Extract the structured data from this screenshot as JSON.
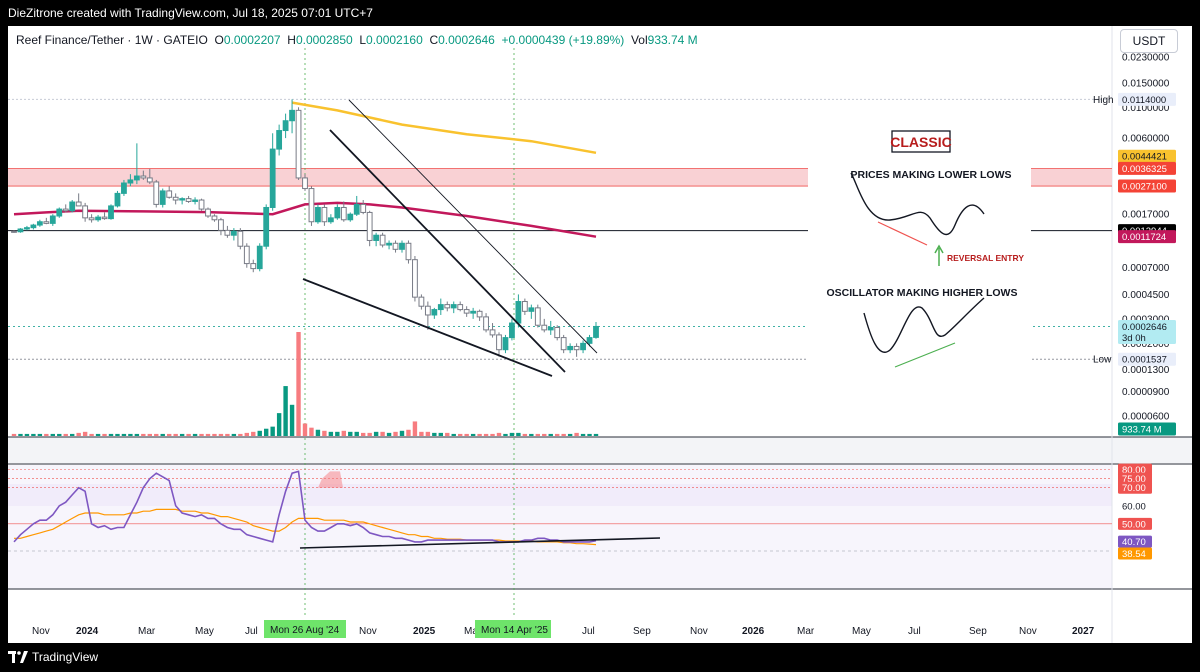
{
  "header": {
    "credit": "DieZitrone created with TradingView.com, Jul 18, 2025 07:01 UTC+7"
  },
  "footer": {
    "brand": "TradingView"
  },
  "legend": {
    "symbol": "Reef Finance/Tether · 1W · GATEIO",
    "o_label": "O",
    "o": "0.0002207",
    "h_label": "H",
    "h": "0.0002850",
    "l_label": "L",
    "l": "0.0002160",
    "c_label": "C",
    "c": "0.0002646",
    "change": "+0.0000439 (+19.89%)",
    "vol_label": "Vol",
    "vol": "933.74 M"
  },
  "currency_button": "USDT",
  "colors": {
    "up": "#26a69a",
    "down": "#ef5350",
    "upvol": "#089981",
    "downvol": "#f77c80",
    "ma_fast": "#f9c22e",
    "ma_slow": "#c2185b",
    "rsi": "#7e57c2",
    "rsi_ma": "#ff9800"
  },
  "chart_data": [
    {
      "type": "candlestick",
      "scale": "log",
      "price_axis_ticks": [
        "0.0230000",
        "0.0150000",
        "0.0100000",
        "0.0060000",
        "0.0027100",
        "0.0017000",
        "0.0007000",
        "0.0004500",
        "0.0003000",
        "0.0002000",
        "0.0001300",
        "0.0000900",
        "0.0000600"
      ],
      "price_labels": [
        {
          "text": "High",
          "value": "0.0114000",
          "kind": "high"
        },
        {
          "text": "",
          "value": "0.0044421",
          "kind": "ma_fast"
        },
        {
          "text": "",
          "value": "0.0036325",
          "kind": "red"
        },
        {
          "text": "",
          "value": "0.0027100",
          "kind": "red"
        },
        {
          "text": "",
          "value": "0.0012944",
          "kind": "black"
        },
        {
          "text": "",
          "value": "0.0011724",
          "kind": "ma_slow"
        },
        {
          "text": "",
          "value": "0.0002646",
          "kind": "last"
        },
        {
          "text": "",
          "value": "3d 0h",
          "kind": "last"
        },
        {
          "text": "Low",
          "value": "0.0001537",
          "kind": "low"
        },
        {
          "text": "",
          "value": "933.74 M",
          "kind": "vol"
        }
      ],
      "time_axis": [
        "Nov",
        "2024",
        "Mar",
        "May",
        "Jul",
        "Sep",
        "Nov",
        "2025",
        "Mar",
        "May",
        "Jul",
        "Sep",
        "Nov",
        "2026",
        "Mar",
        "May",
        "Jul",
        "Sep",
        "Nov",
        "2027"
      ],
      "time_highlights": [
        "Mon 26 Aug '24",
        "Mon 14 Apr '25"
      ],
      "candles": [
        [
          0.00128,
          0.0013,
          0.00125,
          0.00127
        ],
        [
          0.00127,
          0.00135,
          0.00125,
          0.00133
        ],
        [
          0.00133,
          0.0014,
          0.0013,
          0.00136
        ],
        [
          0.00136,
          0.00145,
          0.00132,
          0.00142
        ],
        [
          0.00142,
          0.00155,
          0.00138,
          0.0015
        ],
        [
          0.0015,
          0.0016,
          0.00144,
          0.00146
        ],
        [
          0.00146,
          0.0017,
          0.0014,
          0.00165
        ],
        [
          0.00165,
          0.0019,
          0.0016,
          0.00185
        ],
        [
          0.00185,
          0.002,
          0.00175,
          0.0018
        ],
        [
          0.0018,
          0.00215,
          0.00175,
          0.00208
        ],
        [
          0.00208,
          0.0024,
          0.002,
          0.00195
        ],
        [
          0.00195,
          0.00205,
          0.0015,
          0.0016
        ],
        [
          0.0016,
          0.0017,
          0.00148,
          0.00155
        ],
        [
          0.00155,
          0.00168,
          0.0015,
          0.00162
        ],
        [
          0.00162,
          0.00175,
          0.00155,
          0.00158
        ],
        [
          0.00158,
          0.002,
          0.00155,
          0.00195
        ],
        [
          0.00195,
          0.0025,
          0.0019,
          0.0024
        ],
        [
          0.0024,
          0.003,
          0.0023,
          0.00285
        ],
        [
          0.00285,
          0.0033,
          0.0027,
          0.003
        ],
        [
          0.003,
          0.0055,
          0.0028,
          0.0032
        ],
        [
          0.0032,
          0.0035,
          0.003,
          0.0031
        ],
        [
          0.0031,
          0.0036,
          0.0028,
          0.0029
        ],
        [
          0.0029,
          0.003,
          0.0019,
          0.002
        ],
        [
          0.002,
          0.0026,
          0.0019,
          0.0025
        ],
        [
          0.0025,
          0.0027,
          0.0022,
          0.00225
        ],
        [
          0.00225,
          0.0024,
          0.002,
          0.00215
        ],
        [
          0.00215,
          0.00225,
          0.002,
          0.0022
        ],
        [
          0.0022,
          0.0023,
          0.00205,
          0.0021
        ],
        [
          0.0021,
          0.00225,
          0.002,
          0.00215
        ],
        [
          0.00215,
          0.0022,
          0.0018,
          0.00185
        ],
        [
          0.00185,
          0.0019,
          0.0016,
          0.00165
        ],
        [
          0.00165,
          0.0017,
          0.0015,
          0.00155
        ],
        [
          0.00155,
          0.0016,
          0.0012,
          0.0013
        ],
        [
          0.0013,
          0.0014,
          0.00115,
          0.0012
        ],
        [
          0.0012,
          0.00135,
          0.0011,
          0.00128
        ],
        [
          0.00128,
          0.00135,
          0.00095,
          0.001
        ],
        [
          0.001,
          0.00105,
          0.0007,
          0.00075
        ],
        [
          0.00075,
          0.0008,
          0.00065,
          0.00069
        ],
        [
          0.00069,
          0.00105,
          0.00066,
          0.001
        ],
        [
          0.001,
          0.002,
          0.00095,
          0.0019
        ],
        [
          0.0019,
          0.0065,
          0.0018,
          0.005
        ],
        [
          0.005,
          0.0075,
          0.0045,
          0.0068
        ],
        [
          0.0068,
          0.009,
          0.006,
          0.008
        ],
        [
          0.008,
          0.0114,
          0.0065,
          0.0095
        ],
        [
          0.0095,
          0.01,
          0.003,
          0.0031
        ],
        [
          0.0031,
          0.0033,
          0.0025,
          0.0026
        ],
        [
          0.0026,
          0.0027,
          0.0014,
          0.0015
        ],
        [
          0.0015,
          0.002,
          0.00145,
          0.0019
        ],
        [
          0.0019,
          0.002,
          0.0014,
          0.0015
        ],
        [
          0.0015,
          0.0017,
          0.00145,
          0.0016
        ],
        [
          0.0016,
          0.002,
          0.00155,
          0.0019
        ],
        [
          0.0019,
          0.0021,
          0.0015,
          0.00155
        ],
        [
          0.00155,
          0.00175,
          0.0015,
          0.0017
        ],
        [
          0.0017,
          0.0023,
          0.00165,
          0.002
        ],
        [
          0.002,
          0.00215,
          0.0017,
          0.00175
        ],
        [
          0.00175,
          0.0018,
          0.001,
          0.0011
        ],
        [
          0.0011,
          0.00125,
          0.001,
          0.0012
        ],
        [
          0.0012,
          0.00125,
          0.00098,
          0.00102
        ],
        [
          0.00102,
          0.0011,
          0.00095,
          0.00105
        ],
        [
          0.00105,
          0.0011,
          0.0009,
          0.00095
        ],
        [
          0.00095,
          0.0011,
          0.0009,
          0.00105
        ],
        [
          0.00105,
          0.0011,
          0.00075,
          0.0008
        ],
        [
          0.0008,
          0.00085,
          0.0004,
          0.00043
        ],
        [
          0.00043,
          0.00045,
          0.00035,
          0.00037
        ],
        [
          0.00037,
          0.0004,
          0.00025,
          0.00032
        ],
        [
          0.00032,
          0.00036,
          0.0003,
          0.00035
        ],
        [
          0.00035,
          0.00042,
          0.00032,
          0.00038
        ],
        [
          0.00038,
          0.0004,
          0.00034,
          0.00036
        ],
        [
          0.00036,
          0.0004,
          0.00033,
          0.00038
        ],
        [
          0.00038,
          0.0004,
          0.00034,
          0.00035
        ],
        [
          0.00035,
          0.00037,
          0.00031,
          0.00033
        ],
        [
          0.00033,
          0.00036,
          0.0003,
          0.00034
        ],
        [
          0.00034,
          0.00035,
          0.00029,
          0.00031
        ],
        [
          0.00031,
          0.00033,
          0.00024,
          0.00025
        ],
        [
          0.00025,
          0.00028,
          0.00022,
          0.00023
        ],
        [
          0.00023,
          0.00024,
          0.00016,
          0.00018
        ],
        [
          0.00018,
          0.00023,
          0.00017,
          0.00022
        ],
        [
          0.00022,
          0.0003,
          0.00021,
          0.00028
        ],
        [
          0.00028,
          0.00045,
          0.00026,
          0.0004
        ],
        [
          0.0004,
          0.00042,
          0.00032,
          0.00034
        ],
        [
          0.00034,
          0.00038,
          0.0003,
          0.00036
        ],
        [
          0.00036,
          0.00038,
          0.00026,
          0.00027
        ],
        [
          0.00027,
          0.0003,
          0.00024,
          0.00025
        ],
        [
          0.00025,
          0.00029,
          0.00023,
          0.00026
        ],
        [
          0.00026,
          0.00027,
          0.00021,
          0.00022
        ],
        [
          0.00022,
          0.00023,
          0.00017,
          0.00018
        ],
        [
          0.00018,
          0.0002,
          0.00017,
          0.00019
        ],
        [
          0.00019,
          0.0002,
          0.00016,
          0.00018
        ],
        [
          0.00018,
          0.00021,
          0.00017,
          0.0002
        ],
        [
          0.0002,
          0.00023,
          0.00019,
          0.00022
        ],
        [
          0.0002207,
          0.000285,
          0.000216,
          0.0002646
        ]
      ],
      "volume": [
        2,
        2,
        2,
        2,
        2,
        2,
        2,
        2,
        2,
        2,
        3,
        4,
        2,
        2,
        2,
        2,
        2,
        2,
        2,
        2,
        2,
        2,
        2,
        2,
        2,
        2,
        2,
        2,
        2,
        2,
        2,
        2,
        2,
        2,
        2,
        2,
        3,
        4,
        5,
        7,
        9,
        22,
        48,
        30,
        100,
        12,
        8,
        6,
        5,
        4,
        4,
        5,
        4,
        4,
        3,
        3,
        4,
        4,
        3,
        4,
        5,
        6,
        14,
        4,
        4,
        3,
        3,
        3,
        2,
        2,
        2,
        2,
        2,
        2,
        2,
        3,
        2,
        3,
        3,
        2,
        2,
        2,
        2,
        2,
        2,
        2,
        2,
        3,
        2,
        2,
        2
      ],
      "ma_fast": [
        [
          43,
          0.0108
        ],
        [
          50,
          0.0095
        ],
        [
          60,
          0.0075
        ],
        [
          70,
          0.0064
        ],
        [
          80,
          0.0057
        ],
        [
          90,
          0.0047
        ]
      ],
      "ma_slow": [
        [
          0,
          0.0017
        ],
        [
          5,
          0.00175
        ],
        [
          10,
          0.0018
        ],
        [
          20,
          0.00178
        ],
        [
          30,
          0.00176
        ],
        [
          40,
          0.0017
        ],
        [
          45,
          0.002
        ],
        [
          50,
          0.00205
        ],
        [
          55,
          0.002
        ],
        [
          60,
          0.0019
        ],
        [
          70,
          0.00165
        ],
        [
          80,
          0.0014
        ],
        [
          90,
          0.00117
        ]
      ],
      "annotation": {
        "title": "CLASSIC",
        "top_label": "PRICES MAKING LOWER LOWS",
        "entry_label": "REVERSAL ENTRY",
        "bottom_label": "OSCILLATOR MAKING HIGHER LOWS"
      }
    },
    {
      "type": "line",
      "name": "",
      "axis_ticks": [
        "80.00",
        "75.00",
        "70.00",
        "60.00",
        "50.00",
        "40.70",
        "38.54"
      ],
      "rsi": [
        40,
        44,
        47,
        50,
        52,
        52,
        55,
        60,
        62,
        66,
        70,
        68,
        50,
        48,
        49,
        47,
        48,
        48,
        55,
        62,
        70,
        75,
        78,
        76,
        74,
        60,
        56,
        55,
        54,
        55,
        53,
        53,
        50,
        48,
        47,
        47,
        44,
        43,
        42,
        41,
        40,
        55,
        68,
        78,
        79,
        52,
        48,
        46,
        46,
        48,
        50,
        50,
        49,
        50,
        48,
        45,
        44,
        43,
        43,
        42,
        42,
        41,
        40,
        40,
        41,
        41,
        41,
        41,
        41,
        41,
        41,
        41,
        41,
        41,
        41,
        40,
        40,
        40,
        40,
        41,
        41,
        42,
        42,
        41,
        41,
        40,
        40,
        40,
        40,
        40,
        40.7
      ],
      "rsi_ma": [
        42,
        42,
        43,
        44,
        45,
        46,
        47,
        49,
        51,
        53,
        55,
        56,
        56,
        56,
        55,
        55,
        55,
        55,
        56,
        56,
        57,
        57,
        58,
        58,
        58,
        58,
        57,
        57,
        57,
        56,
        56,
        55,
        54,
        54,
        53,
        52,
        51,
        49,
        48,
        47,
        46,
        46,
        48,
        51,
        53,
        53,
        53,
        53,
        52,
        52,
        52,
        52,
        51,
        51,
        51,
        50,
        49,
        48,
        47,
        46,
        45,
        44,
        44,
        43,
        43,
        42,
        42,
        41.5,
        41.5,
        41.5,
        41,
        41,
        41,
        41,
        41,
        41,
        40.5,
        40.5,
        40.5,
        40.5,
        40.5,
        40,
        40,
        40,
        40,
        39.5,
        39.5,
        39,
        39,
        38.8,
        38.54
      ]
    }
  ]
}
